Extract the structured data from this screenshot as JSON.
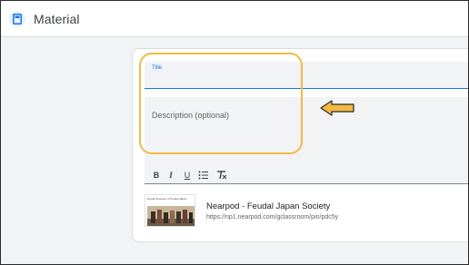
{
  "app": {
    "title": "Material",
    "icon": "material-doc-icon",
    "accent_color": "#1a73e8"
  },
  "form": {
    "title_label": "Title",
    "description_placeholder": "Description (optional)"
  },
  "toolbar": {
    "bold": "B",
    "italic": "I",
    "underline": "U",
    "icons": [
      "bold-icon",
      "italic-icon",
      "underline-icon",
      "bulleted-list-icon",
      "clear-formatting-icon"
    ]
  },
  "attachment": {
    "thumbnail_caption": "Social Structure of Feudal Japan",
    "title": "Nearpod - Feudal Japan Society",
    "url": "https://np1.nearpod.com/gclassroom/pin/pdc5y"
  },
  "annotations": {
    "highlight_color": "#f4b942",
    "arrow_color": "#f4b942",
    "arrow_direction": "left"
  }
}
